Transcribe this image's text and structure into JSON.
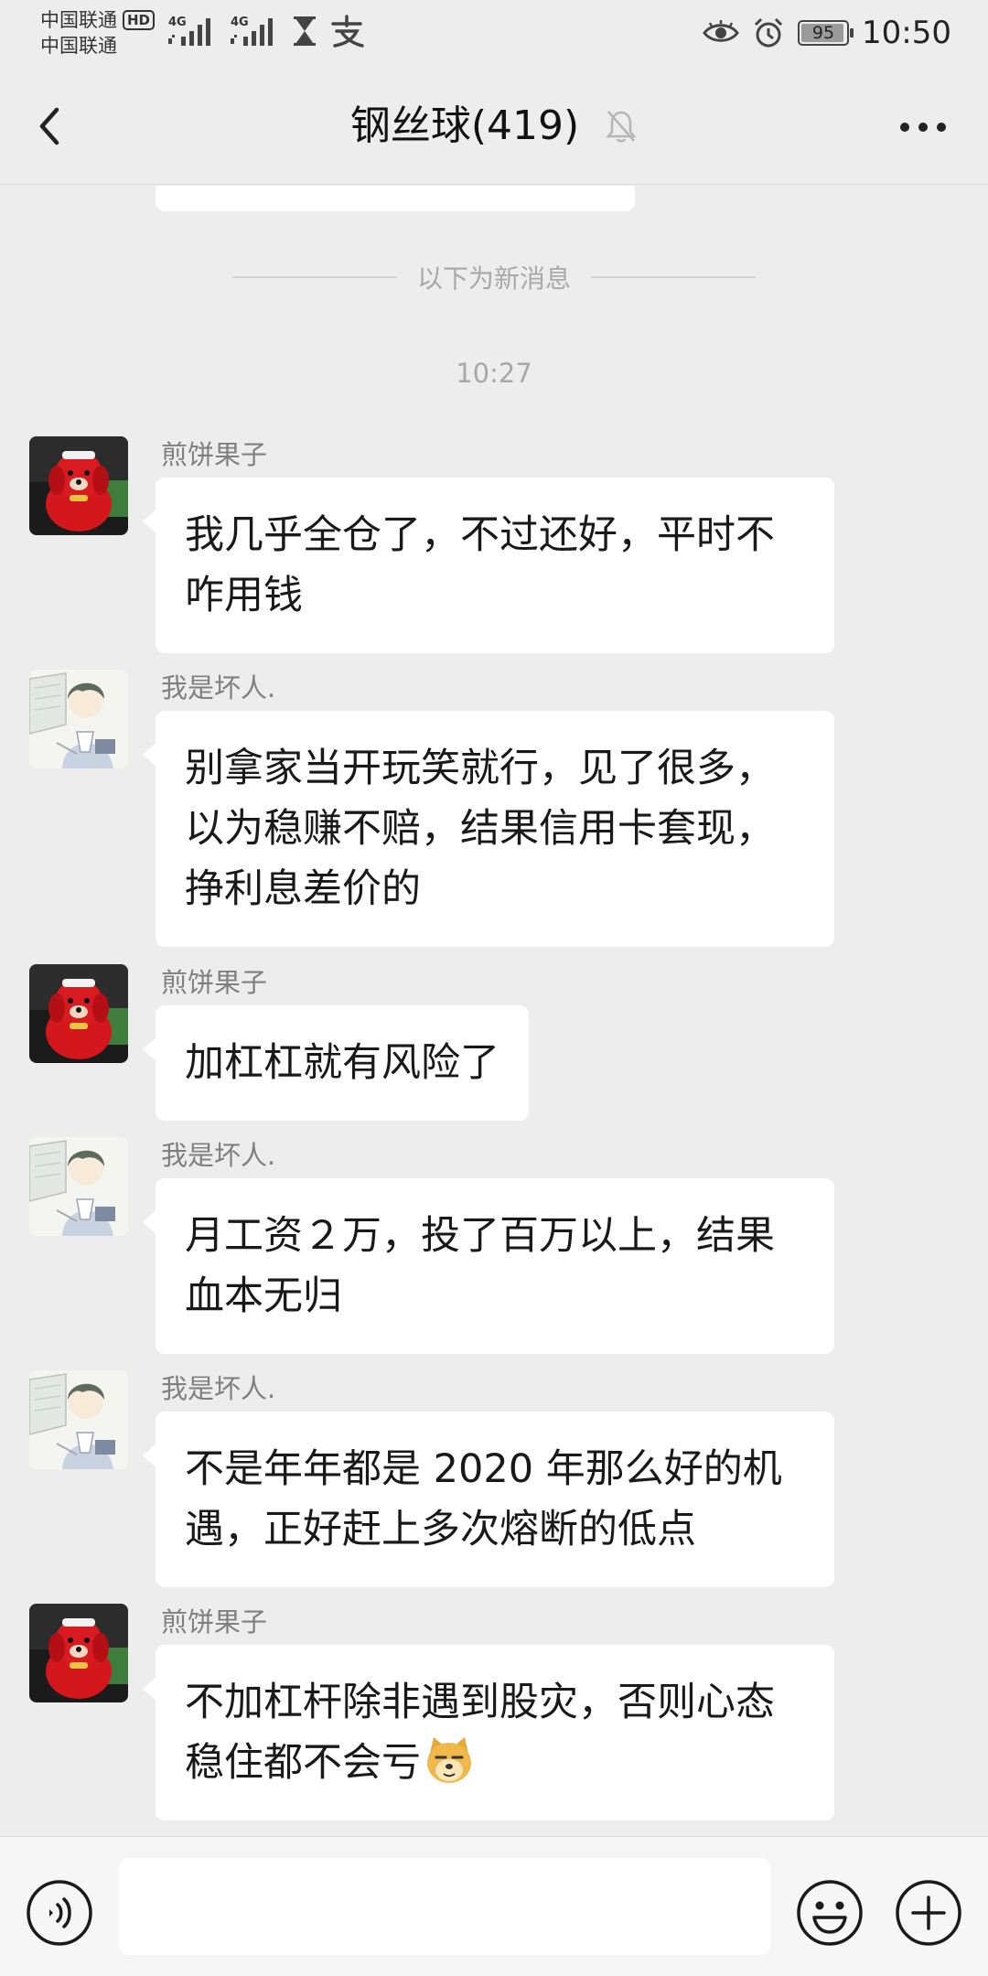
{
  "status_bar": {
    "carrier_1": "中国联通",
    "carrier_2": "中国联通",
    "hd_badge": "HD",
    "network_1": "4G",
    "network_2": "4G",
    "battery_percent": "95",
    "time": "10:50"
  },
  "nav": {
    "title": "钢丝球(419)",
    "muted": true
  },
  "chat": {
    "new_messages_divider": "以下为新消息",
    "timestamp": "10:27",
    "messages": [
      {
        "sender": "煎饼果子",
        "avatar": "red-dog-avatar",
        "text": "我几乎全仓了，不过还好，平时不咋用钱"
      },
      {
        "sender": "我是坏人.",
        "avatar": "anime-boy-avatar",
        "text": "别拿家当开玩笑就行，见了很多，以为稳赚不赔，结果信用卡套现，挣利息差价的"
      },
      {
        "sender": "煎饼果子",
        "avatar": "red-dog-avatar",
        "text": "加杠杠就有风险了"
      },
      {
        "sender": "我是坏人.",
        "avatar": "anime-boy-avatar",
        "text": "月工资２万，投了百万以上，结果血本无归"
      },
      {
        "sender": "我是坏人.",
        "avatar": "anime-boy-avatar",
        "text": "不是年年都是 2020 年那么好的机遇，正好赶上多次熔断的低点"
      },
      {
        "sender": "煎饼果子",
        "avatar": "red-dog-avatar",
        "text": "不加杠杆除非遇到股灾，否则心态稳住都不会亏",
        "emoji": "doge"
      }
    ]
  },
  "input_bar": {
    "text_value": ""
  }
}
